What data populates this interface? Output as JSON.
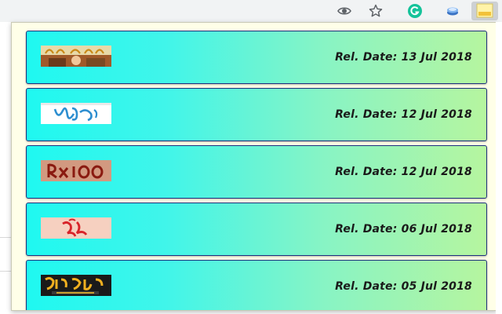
{
  "browser": {
    "icons": [
      "eye-icon",
      "star-icon",
      "grammarly-icon",
      "extension-icon",
      "active-extension-icon"
    ],
    "grammarly_color": "#15c39a"
  },
  "movies": [
    {
      "date_label": "Rel. Date: 13 Jul 2018",
      "poster_icon": "poster-thumbnail"
    },
    {
      "date_label": "Rel. Date: 12 Jul 2018",
      "poster_icon": "poster-thumbnail"
    },
    {
      "date_label": "Rel. Date: 12 Jul 2018",
      "poster_icon": "poster-thumbnail"
    },
    {
      "date_label": "Rel. Date: 06 Jul 2018",
      "poster_icon": "poster-thumbnail"
    },
    {
      "date_label": "Rel. Date: 05 Jul 2018",
      "poster_icon": "poster-thumbnail"
    }
  ],
  "colors": {
    "card_gradient_start": "#1ff8f0",
    "card_gradient_end": "#b6f59f",
    "card_border": "#1e2f7d",
    "popup_background": "#ffffe8"
  }
}
